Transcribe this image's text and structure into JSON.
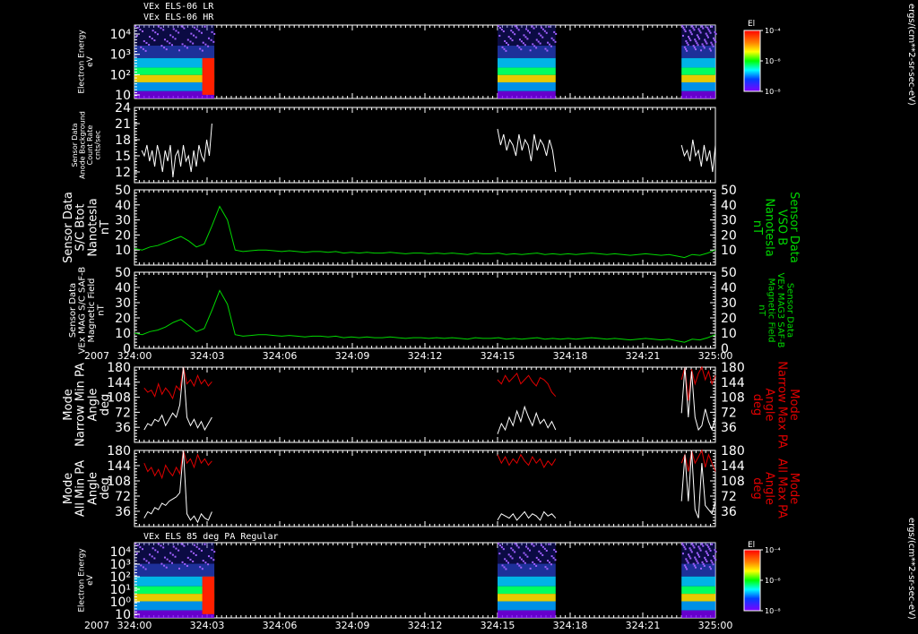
{
  "header": {
    "line1": "VEx ELS-06 LR",
    "line2": "VEx ELS-06 HR",
    "line3": "VEx ELS 85 deg PA Regular"
  },
  "year_label": "2007",
  "time_ticks": [
    "324:00",
    "324:03",
    "324:06",
    "324:09",
    "324:12",
    "324:15",
    "324:18",
    "324:21",
    "325:00"
  ],
  "colorbar": {
    "title": "El",
    "unit": "ergs/(cm**2-sr-sec-eV)",
    "ticks": [
      "10⁻⁴",
      "10⁻⁶",
      "10⁻⁸"
    ]
  },
  "colors": {
    "white": "#ffffff",
    "green": "#00d800",
    "red": "#e00000",
    "axis": "#ffffff"
  },
  "chart_data": [
    {
      "type": "heatmap",
      "id": "p1",
      "ylabel": [
        "Electron Energy",
        "eV"
      ],
      "yticks": [
        "10⁴",
        "10³",
        "10²",
        "10"
      ],
      "blocks": [
        [
          0,
          3.3
        ],
        [
          15.0,
          17.4
        ],
        [
          22.6,
          24.0
        ]
      ]
    },
    {
      "type": "line",
      "id": "p2",
      "ylabel": [
        "Sensor Data",
        "Anode Background",
        "Count Rate",
        "cnts/sec"
      ],
      "ylim": [
        10,
        24
      ],
      "yticks": [
        12,
        15,
        18,
        21,
        24
      ],
      "series": [
        {
          "color": "white",
          "segments": [
            {
              "x0": 0.3,
              "x1": 3.2,
              "values": [
                16,
                15,
                17,
                14,
                16,
                13,
                17,
                15,
                12,
                16,
                14,
                17,
                11,
                15,
                16,
                13,
                17,
                14,
                15,
                12,
                16,
                13,
                17,
                15,
                14,
                18,
                15,
                21
              ]
            },
            {
              "x0": 15.0,
              "x1": 17.4,
              "values": [
                20,
                17,
                19,
                16,
                18,
                17,
                15,
                19,
                16,
                18,
                17,
                14,
                19,
                16,
                18,
                17,
                15,
                18,
                16,
                12
              ]
            },
            {
              "x0": 22.6,
              "x1": 24.0,
              "values": [
                17,
                15,
                16,
                14,
                18,
                15,
                16,
                13,
                17,
                14,
                16,
                12,
                17
              ]
            }
          ]
        }
      ]
    },
    {
      "type": "line",
      "id": "p3",
      "ylabel": [
        "Sensor Data",
        "S/C Btot",
        "Nanotesla",
        "nT"
      ],
      "ylabel_right": [
        "Sensor Data",
        "VSO B",
        "Nanotesla",
        "nT"
      ],
      "ylim": [
        0,
        50
      ],
      "yticks": [
        10,
        20,
        30,
        40,
        50
      ],
      "series": [
        {
          "color": "green",
          "x0": 0,
          "x1": 24,
          "values": [
            11,
            10,
            12,
            13,
            15,
            17,
            19,
            16,
            12,
            14,
            26,
            39,
            30,
            10,
            9,
            9.5,
            10,
            10,
            9.5,
            9,
            9.5,
            9,
            8.5,
            9,
            9,
            8.5,
            9,
            8,
            8.5,
            8,
            8.5,
            8,
            8,
            8.5,
            8,
            7.5,
            8,
            8,
            7.5,
            8,
            7.5,
            8,
            7.5,
            7,
            8,
            7.5,
            7.5,
            8,
            7,
            7.5,
            7,
            7.5,
            8,
            7,
            7.5,
            7,
            7.5,
            7,
            7.5,
            8,
            7.5,
            7,
            7.5,
            7,
            6.5,
            7,
            7.5,
            7,
            6.5,
            7,
            6,
            5,
            7,
            6.5,
            8,
            10
          ]
        }
      ]
    },
    {
      "type": "line",
      "id": "p4",
      "ylabel": [
        "Sensor Data",
        "VEx MAG S/C SAF-B",
        "Magnetic Field",
        "nT"
      ],
      "ylabel_right": [
        "Sensor Data",
        "VEx MAG3 SAF-B",
        "Magnetic Field",
        "nT"
      ],
      "ylim": [
        0,
        50
      ],
      "yticks": [
        0,
        10,
        20,
        30,
        40,
        50
      ],
      "series": [
        {
          "color": "green",
          "x0": 0,
          "x1": 24,
          "values": [
            10,
            9,
            11,
            12,
            14,
            17,
            19,
            15,
            11,
            13,
            25,
            38,
            29,
            9,
            8,
            8.5,
            9,
            9,
            8.5,
            8,
            8.5,
            8,
            7.5,
            8,
            8,
            7.5,
            8,
            7,
            7.5,
            7,
            7.5,
            7,
            7,
            7.5,
            7,
            6.5,
            7,
            7,
            6.5,
            7,
            6.5,
            7,
            6.5,
            6,
            7,
            6.5,
            6.5,
            7,
            6,
            6.5,
            6,
            6.5,
            7,
            6,
            6.5,
            6,
            6.5,
            6,
            6.5,
            7,
            6.5,
            6,
            6.5,
            6,
            5.5,
            6,
            6.5,
            6,
            5.5,
            6,
            5,
            4,
            6,
            5.5,
            7,
            9
          ]
        }
      ]
    },
    {
      "type": "line",
      "id": "p5",
      "ylabel": [
        "Mode",
        "Narrow Min PA",
        "Angle",
        "deg"
      ],
      "ylabel_right": [
        "Mode",
        "Narrow Max PA",
        "Angle",
        "deg"
      ],
      "ylim": [
        0,
        180
      ],
      "yticks": [
        36,
        72,
        108,
        144,
        180
      ],
      "series": [
        {
          "color": "red",
          "segments": [
            {
              "x0": 0.4,
              "x1": 3.2,
              "values": [
                130,
                120,
                125,
                110,
                140,
                115,
                130,
                120,
                105,
                135,
                125,
                180,
                140,
                150,
                135,
                160,
                140,
                150,
                135,
                145
              ]
            },
            {
              "x0": 15.0,
              "x1": 17.4,
              "values": [
                150,
                140,
                160,
                145,
                155,
                165,
                140,
                150,
                160,
                145,
                135,
                155,
                150,
                140,
                120,
                110
              ]
            },
            {
              "x0": 22.6,
              "x1": 24.0,
              "values": [
                150,
                180,
                100,
                175,
                140,
                165,
                180,
                150,
                170,
                140,
                160
              ]
            }
          ]
        },
        {
          "color": "white",
          "segments": [
            {
              "x0": 0.4,
              "x1": 3.2,
              "values": [
                30,
                45,
                40,
                55,
                50,
                65,
                40,
                55,
                70,
                60,
                90,
                180,
                60,
                40,
                55,
                35,
                50,
                30,
                45,
                60
              ]
            },
            {
              "x0": 15.0,
              "x1": 17.4,
              "values": [
                20,
                45,
                30,
                60,
                40,
                75,
                50,
                85,
                60,
                40,
                70,
                45,
                55,
                35,
                50,
                30
              ]
            },
            {
              "x0": 22.6,
              "x1": 24.0,
              "values": [
                70,
                180,
                60,
                170,
                60,
                30,
                40,
                80,
                50,
                30,
                60
              ]
            }
          ]
        }
      ]
    },
    {
      "type": "line",
      "id": "p6",
      "ylabel": [
        "Mode",
        "All Min PA",
        "Angle",
        "deg"
      ],
      "ylabel_right": [
        "Mode",
        "All Max PA",
        "Angle",
        "deg"
      ],
      "ylim": [
        0,
        180
      ],
      "yticks": [
        36,
        72,
        108,
        144,
        180
      ],
      "series": [
        {
          "color": "red",
          "segments": [
            {
              "x0": 0.4,
              "x1": 3.2,
              "values": [
                150,
                130,
                140,
                120,
                135,
                115,
                145,
                130,
                120,
                140,
                125,
                180,
                150,
                160,
                140,
                170,
                150,
                160,
                145,
                155
              ]
            },
            {
              "x0": 15.0,
              "x1": 17.4,
              "values": [
                170,
                150,
                165,
                145,
                160,
                150,
                170,
                155,
                145,
                165,
                150,
                160,
                140,
                155,
                145,
                160
              ]
            },
            {
              "x0": 22.6,
              "x1": 24.0,
              "values": [
                150,
                170,
                130,
                180,
                150,
                165,
                180,
                140,
                170,
                150,
                130
              ]
            }
          ]
        },
        {
          "color": "white",
          "segments": [
            {
              "x0": 0.4,
              "x1": 3.2,
              "values": [
                20,
                35,
                30,
                45,
                40,
                55,
                50,
                60,
                65,
                70,
                80,
                180,
                30,
                15,
                25,
                10,
                30,
                20,
                15,
                35
              ]
            },
            {
              "x0": 15.0,
              "x1": 17.4,
              "values": [
                15,
                30,
                25,
                20,
                30,
                15,
                25,
                35,
                20,
                30,
                25,
                15,
                35,
                25,
                30,
                20
              ]
            },
            {
              "x0": 22.6,
              "x1": 24.0,
              "values": [
                60,
                170,
                60,
                180,
                40,
                20,
                150,
                50,
                40,
                30,
                60
              ]
            }
          ]
        }
      ]
    },
    {
      "type": "heatmap",
      "id": "p7",
      "ylabel": [
        "Electron Energy",
        "eV"
      ],
      "yticks": [
        "10⁴",
        "10³",
        "10²",
        "10¹",
        "10⁰",
        "10"
      ],
      "blocks": [
        [
          0,
          3.3
        ],
        [
          15.0,
          17.4
        ],
        [
          22.6,
          24.0
        ]
      ]
    }
  ]
}
